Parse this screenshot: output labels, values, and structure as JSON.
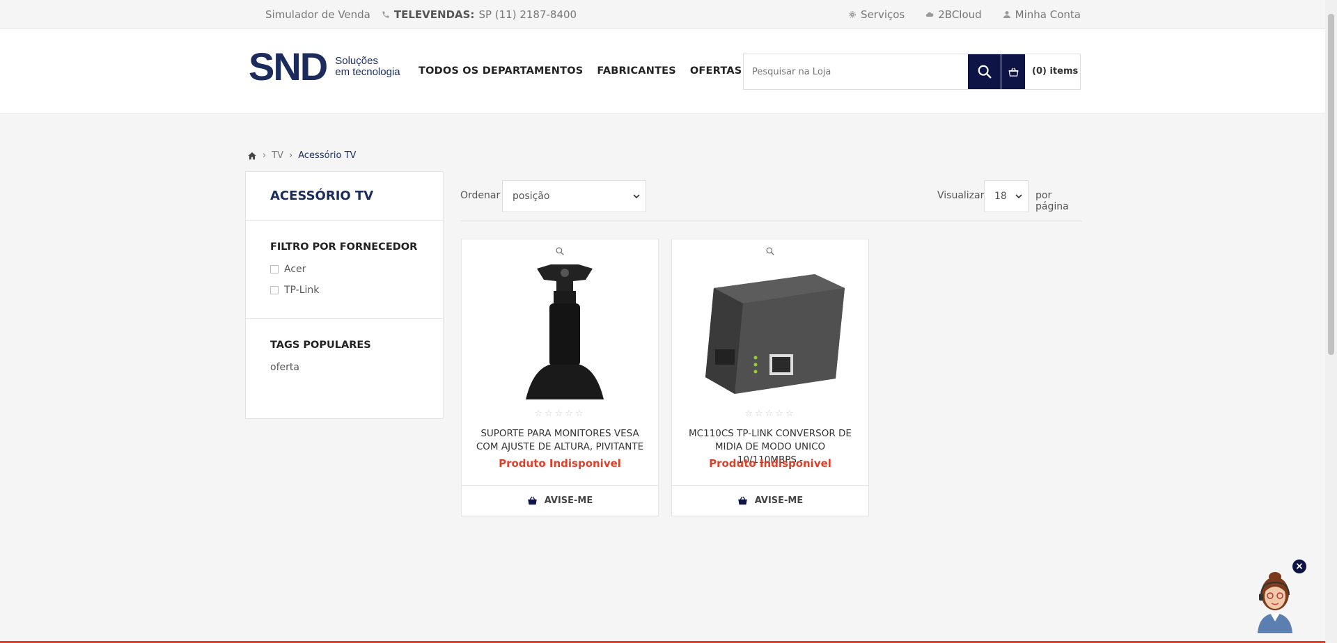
{
  "topbar": {
    "simulator": "Simulador de Venda",
    "phone_label": "TELEVENDAS:",
    "phone_number": "SP (11)  2187-8400",
    "services": "Serviços",
    "cloud": "2BCloud",
    "account": "Minha Conta"
  },
  "logo": {
    "mark": "SND",
    "line1": "Soluções",
    "line2": "em tecnologia"
  },
  "nav": {
    "departments": "TODOS OS DEPARTAMENTOS",
    "manufacturers": "FABRICANTES",
    "offers": "OFERTAS DO DIA"
  },
  "search": {
    "placeholder": "Pesquisar na Loja"
  },
  "cart": {
    "label": "(0) items"
  },
  "breadcrumb": {
    "level1": "TV",
    "current": "Acessório TV"
  },
  "sidebar": {
    "title": "ACESSÓRIO TV",
    "filter_title": "FILTRO POR FORNECEDOR",
    "filters": [
      "Acer",
      "TP-Link"
    ],
    "tags_title": "TAGS POPULARES",
    "tags": [
      "oferta"
    ]
  },
  "toolbar": {
    "sort_label": "Ordenar",
    "sort_value": "posição",
    "view_label": "Visualizar",
    "view_value": "18",
    "per_page": "por página"
  },
  "products": [
    {
      "name": "SUPORTE PARA MONITORES VESA COM AJUSTE DE ALTURA, PIVITANTE",
      "status": "Produto Indisponivel",
      "action": "AVISE-ME",
      "rating": 0
    },
    {
      "name": "MC110CS TP-LINK CONVERSOR DE MIDIA DE MODO UNICO 10/110MBPS -",
      "status": "Produto Indisponivel",
      "action": "AVISE-ME",
      "rating": 0
    }
  ],
  "colors": {
    "navy": "#0f1446",
    "brand_blue": "#1a2b5c",
    "accent_red": "#e0402a"
  }
}
